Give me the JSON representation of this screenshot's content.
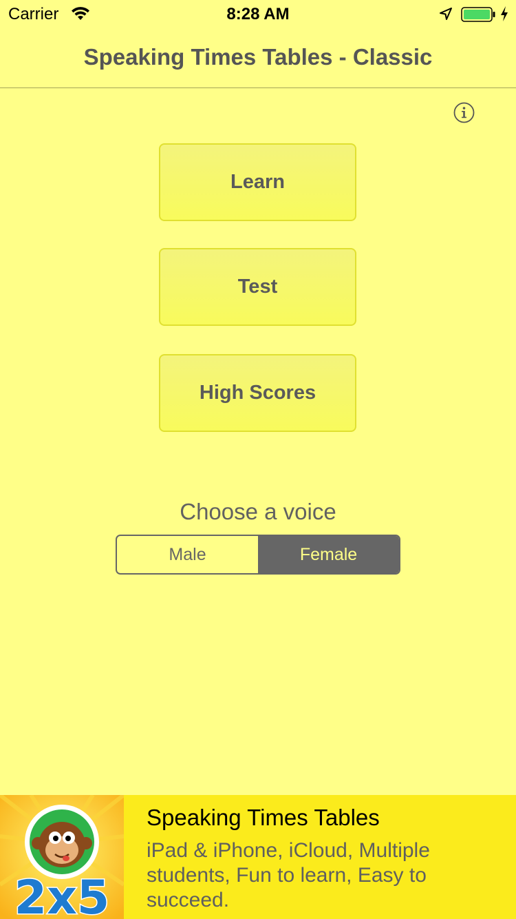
{
  "status_bar": {
    "carrier": "Carrier",
    "time": "8:28 AM",
    "battery_color": "#4cd964"
  },
  "nav": {
    "title": "Speaking Times Tables - Classic",
    "info_icon": "info-icon"
  },
  "menu": {
    "learn_label": "Learn",
    "test_label": "Test",
    "high_scores_label": "High Scores"
  },
  "voice": {
    "label": "Choose a voice",
    "options": [
      "Male",
      "Female"
    ],
    "selected": "Female"
  },
  "ad": {
    "logo_text": "2x5",
    "title": "Speaking Times Tables",
    "description": "iPad & iPhone, iCloud, Multiple students, Fun to learn, Easy to succeed."
  },
  "colors": {
    "background": "#ffff88",
    "button_fill": "#f6f86a",
    "button_border": "#e0e030",
    "text_gray": "#5a5a5a",
    "segment_selected": "#666666",
    "ad_background": "#fbeb1c",
    "ad_logo_blue": "#1e7bd0"
  }
}
